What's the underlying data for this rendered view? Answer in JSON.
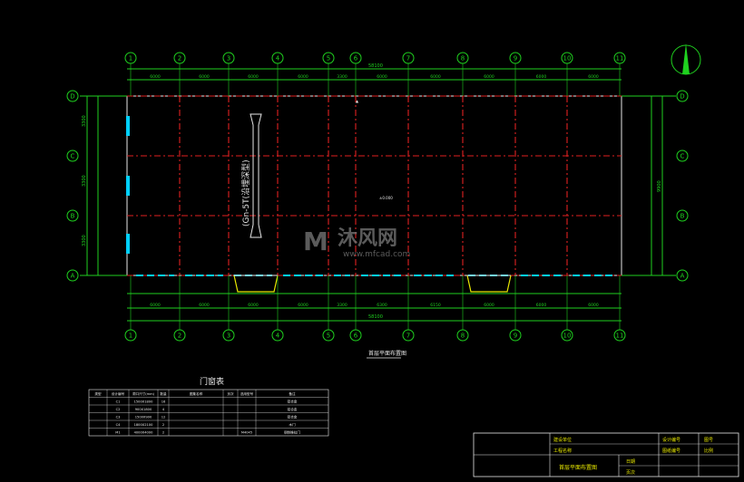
{
  "axes_top": [
    "1",
    "2",
    "3",
    "4",
    "5",
    "6",
    "7",
    "8",
    "9",
    "10",
    "11"
  ],
  "axes_side": [
    "D",
    "C",
    "B",
    "A"
  ],
  "total_dim": "58100",
  "top_spans": [
    "6000",
    "6000",
    "6000",
    "6000",
    "3300",
    "6000",
    "6000",
    "6000",
    "6000",
    "6000"
  ],
  "bottom_spans": [
    "6000",
    "6000",
    "6000",
    "6000",
    "3300",
    "6300",
    "6150",
    "6000",
    "6000",
    "6000"
  ],
  "side_dims": [
    "3300",
    "3300",
    "3300"
  ],
  "side_total": "9900",
  "trench_label": "(Gn-5T(沿埋深型)",
  "title_label": "首层平面布置图",
  "door_table": {
    "title": "门窗表",
    "headers": [
      "类型",
      "设计编号",
      "洞口尺寸(mm)",
      "数量",
      "图集名称",
      "页次",
      "选用型号",
      "备注"
    ],
    "rows": [
      [
        "",
        "C1",
        "1500X1800",
        "16",
        "",
        "",
        "",
        "铝合金"
      ],
      [
        "",
        "C2",
        "900X1800",
        "4",
        "",
        "",
        "",
        "铝合金"
      ],
      [
        "",
        "C3",
        "1500X900",
        "12",
        "",
        "",
        "",
        "铝合金"
      ],
      [
        "",
        "C4",
        "1800X2100",
        "2",
        "",
        "",
        "",
        "木门"
      ],
      [
        "",
        "M1",
        "4000X4000",
        "2",
        "",
        "",
        "M4045",
        "钢制推拉门"
      ]
    ]
  },
  "title_block": {
    "row1_left": "建设单位",
    "row2_left": "工程名称",
    "row1_right": "设计编号",
    "row2_right": "图纸编号",
    "sheet": "图号",
    "scale": "比例",
    "drawing_name": "首层平面布置图",
    "date": "日期",
    "page": "页次"
  },
  "watermark": {
    "brand": "沐风网",
    "url": "www.mfcad.com"
  },
  "colors": {
    "grid": "#1fd11f",
    "axis_line": "#e02020",
    "background": "#000000",
    "window": "#00d0ff"
  }
}
